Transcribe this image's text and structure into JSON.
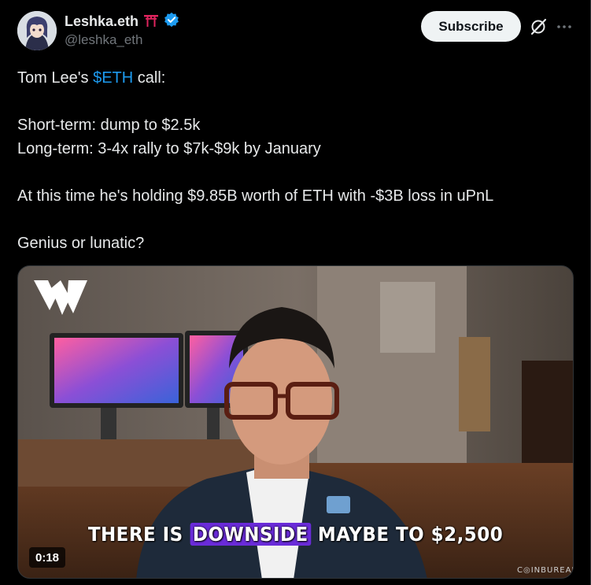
{
  "author": {
    "display_name": "Leshka.eth",
    "handle": "@leshka_eth",
    "emoji": "⛩",
    "verified": true
  },
  "actions": {
    "subscribe_label": "Subscribe"
  },
  "tweet": {
    "line1_prefix": "Tom Lee's ",
    "cashtag": "$ETH",
    "line1_suffix": " call:",
    "short_term": "Short-term: dump to $2.5k",
    "long_term": "Long-term: 3-4x rally to $7k-$9k by January",
    "holding": "At this time he's holding $9.85B worth of ETH with -$3B loss in uPnL",
    "question": "Genius or lunatic?"
  },
  "video": {
    "caption_before": "THERE IS ",
    "caption_highlight": "DOWNSIDE",
    "caption_after": " MAYBE TO $2,500",
    "duration": "0:18",
    "watermark": "C◎INBUREAU"
  },
  "colors": {
    "accent": "#1d9bf0",
    "caption_highlight": "#6a2bd9",
    "verified": "#1d9bf0"
  },
  "icons": [
    "verified-badge-icon",
    "torii-gate-icon",
    "grok-icon",
    "more-icon",
    "brand-logo-icon"
  ]
}
